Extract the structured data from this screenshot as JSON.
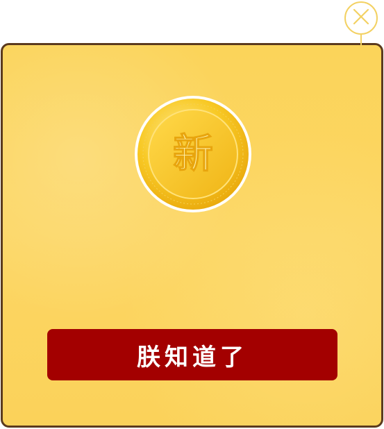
{
  "dialog": {
    "close_icon": "close-icon",
    "coin_icon": "new-coin-icon",
    "coin_character": "新",
    "ack_button_label": "朕知道了"
  },
  "colors": {
    "modal_background": "#fcd663",
    "modal_border": "#5b3a1e",
    "button_background": "#a30000",
    "button_text": "#ffffff",
    "close_outline": "#f3d162",
    "coin_gold": "#f7c51c"
  }
}
